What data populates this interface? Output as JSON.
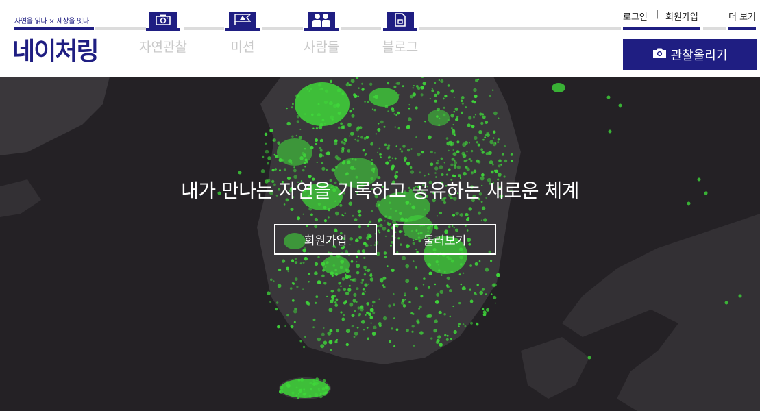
{
  "brand": {
    "tagline_left": "자연을 읽다",
    "tagline_x": "×",
    "tagline_right": "세상을 잇다",
    "logo": "네이처링"
  },
  "nav": {
    "items": [
      {
        "label": "자연관찰",
        "icon": "camera-icon"
      },
      {
        "label": "미션",
        "icon": "flag-icon"
      },
      {
        "label": "사람들",
        "icon": "people-icon"
      },
      {
        "label": "블로그",
        "icon": "document-icon"
      }
    ]
  },
  "top_links": {
    "login": "로그인",
    "separator": "|",
    "signup": "회원가입",
    "more": "더 보기"
  },
  "upload": {
    "label": "관찰올리기",
    "icon": "camera-icon"
  },
  "hero": {
    "title": "내가 만나는 자연을 기록하고 공유하는 새로운 체계",
    "signup_button": "회원가입",
    "browse_button": "둘러보기"
  },
  "colors": {
    "brand": "#1f1e82",
    "hero_background": "#242125",
    "land": "#3a373b",
    "observation_dots": "#3fd63a"
  }
}
